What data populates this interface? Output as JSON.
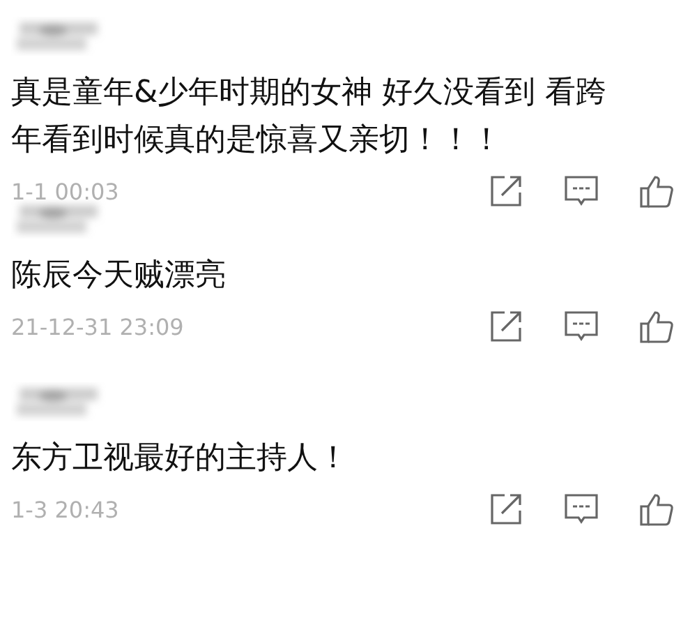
{
  "comments": [
    {
      "text": "真是童年&少年时期的女神 好久没看到 看跨年看到时候真的是惊喜又亲切！！！",
      "time": "1-1 00:03"
    },
    {
      "text": "陈辰今天贼漂亮",
      "time": "21-12-31 23:09"
    },
    {
      "text": "东方卫视最好的主持人！",
      "time": "1-3 20:43"
    }
  ]
}
